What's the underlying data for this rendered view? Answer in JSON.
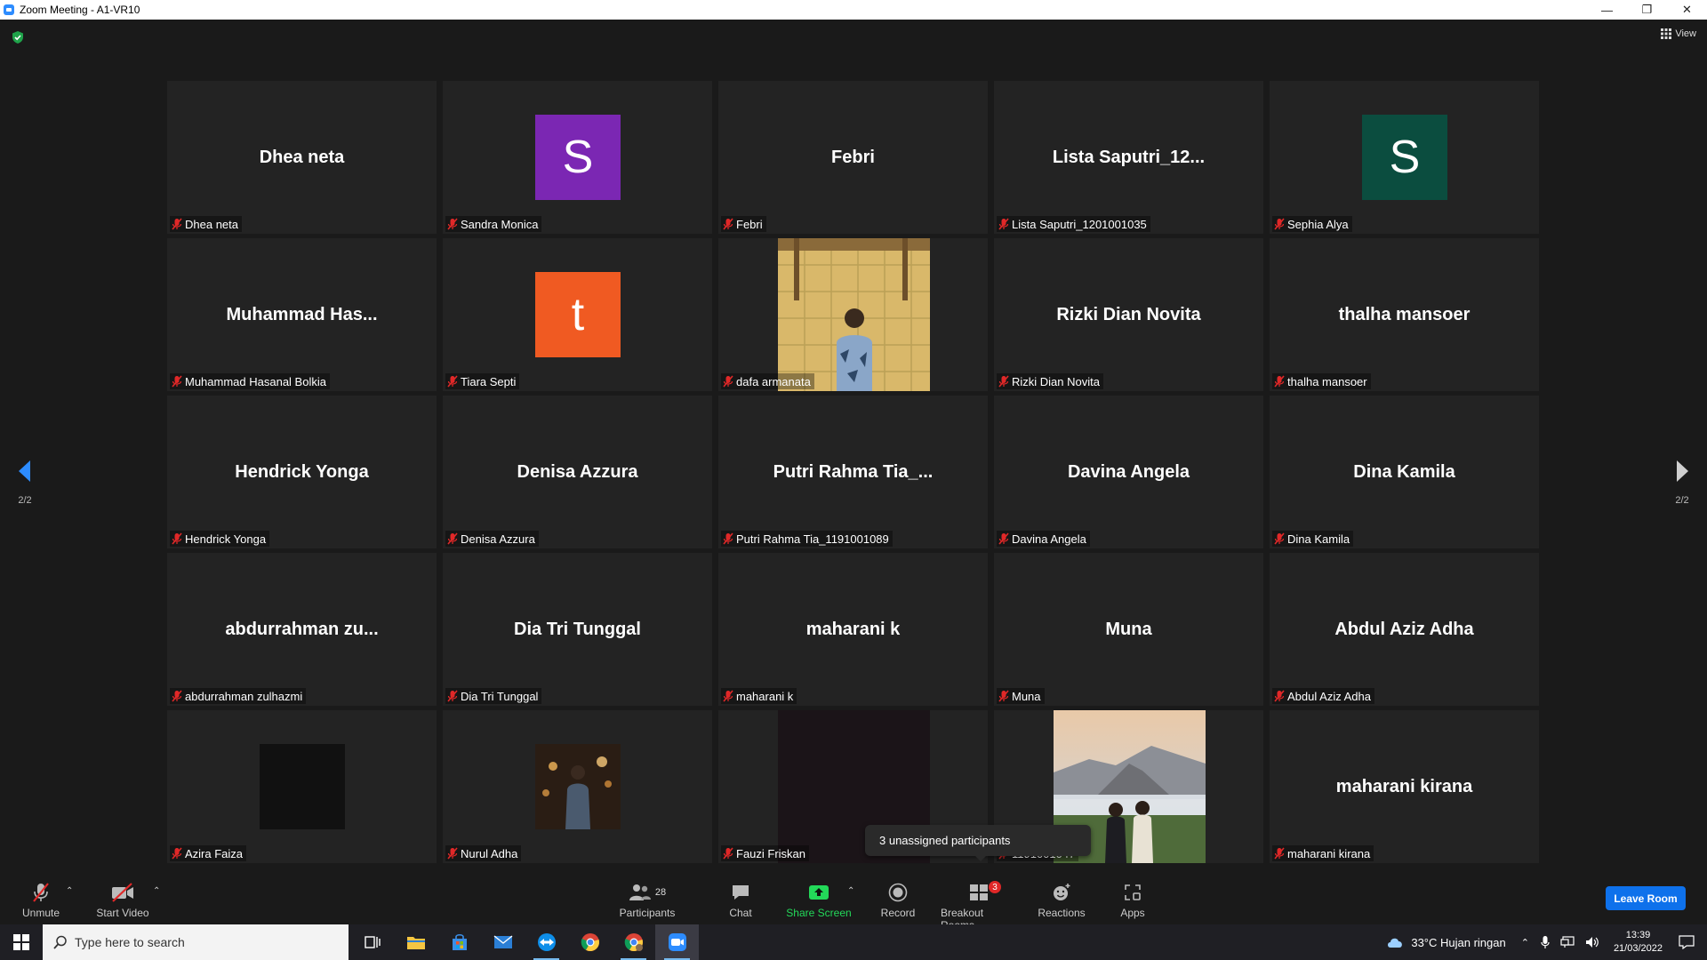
{
  "window": {
    "title": "Zoom Meeting - A1-VR10"
  },
  "top": {
    "view_label": "View"
  },
  "nav": {
    "page_left": "2/2",
    "page_right": "2/2"
  },
  "tiles": [
    {
      "big": "Dhea neta",
      "label": "Dhea neta"
    },
    {
      "avatar": "S",
      "avatar_color": "#7b27b3",
      "label": "Sandra Monica"
    },
    {
      "big": "Febri",
      "label": "Febri"
    },
    {
      "big": "Lista  Saputri_12...",
      "label": "Lista Saputri_1201001035"
    },
    {
      "avatar": "S",
      "avatar_color": "#0b4d3f",
      "label": "Sephia Alya"
    },
    {
      "big": "Muhammad  Has...",
      "label": "Muhammad Hasanal Bolkia"
    },
    {
      "avatar": "t",
      "avatar_color": "#f05a22",
      "label": "Tiara Septi"
    },
    {
      "photo": "person-photo",
      "label": "dafa armanata"
    },
    {
      "big": "Rizki Dian Novita",
      "label": "Rizki Dian Novita"
    },
    {
      "big": "thalha mansoer",
      "label": "thalha mansoer"
    },
    {
      "big": "Hendrick Yonga",
      "label": "Hendrick Yonga"
    },
    {
      "big": "Denisa Azzura",
      "label": "Denisa Azzura"
    },
    {
      "big": "Putri Rahma Tia_...",
      "label": "Putri Rahma Tia_1191001089"
    },
    {
      "big": "Davina Angela",
      "label": "Davina Angela"
    },
    {
      "big": "Dina Kamila",
      "label": "Dina Kamila"
    },
    {
      "big": "abdurrahman  zu...",
      "label": "abdurrahman zulhazmi"
    },
    {
      "big": "Dia Tri Tunggal",
      "label": "Dia Tri Tunggal"
    },
    {
      "big": "maharani k",
      "label": "maharani k"
    },
    {
      "big": "Muna",
      "label": "Muna"
    },
    {
      "big": "Abdul Aziz Adha",
      "label": "Abdul Aziz Adha"
    },
    {
      "avatar": "",
      "avatar_color": "#111111",
      "label": "Azira Faiza"
    },
    {
      "photo": "night-photo",
      "label": "Nurul Adha"
    },
    {
      "photo": "dark-video",
      "label": "Fauzi Friskan"
    },
    {
      "photo": "mountain-photo",
      "label": "1191001047"
    },
    {
      "big": "maharani kirana",
      "label": "maharani kirana"
    }
  ],
  "tooltip": {
    "text": "3 unassigned participants"
  },
  "toolbar": {
    "unmute": "Unmute",
    "start_video": "Start Video",
    "participants": "Participants",
    "participants_count": "28",
    "chat": "Chat",
    "share_screen": "Share Screen",
    "record": "Record",
    "breakout_rooms": "Breakout Rooms",
    "breakout_badge": "3",
    "reactions": "Reactions",
    "apps": "Apps",
    "leave": "Leave Room"
  },
  "taskbar": {
    "search_placeholder": "Type here to search",
    "weather": "33°C  Hujan ringan",
    "time": "13:39",
    "date": "21/03/2022"
  },
  "colors": {
    "accent": "#0e71eb",
    "share_green": "#23d959",
    "badge_red": "#e02828"
  }
}
